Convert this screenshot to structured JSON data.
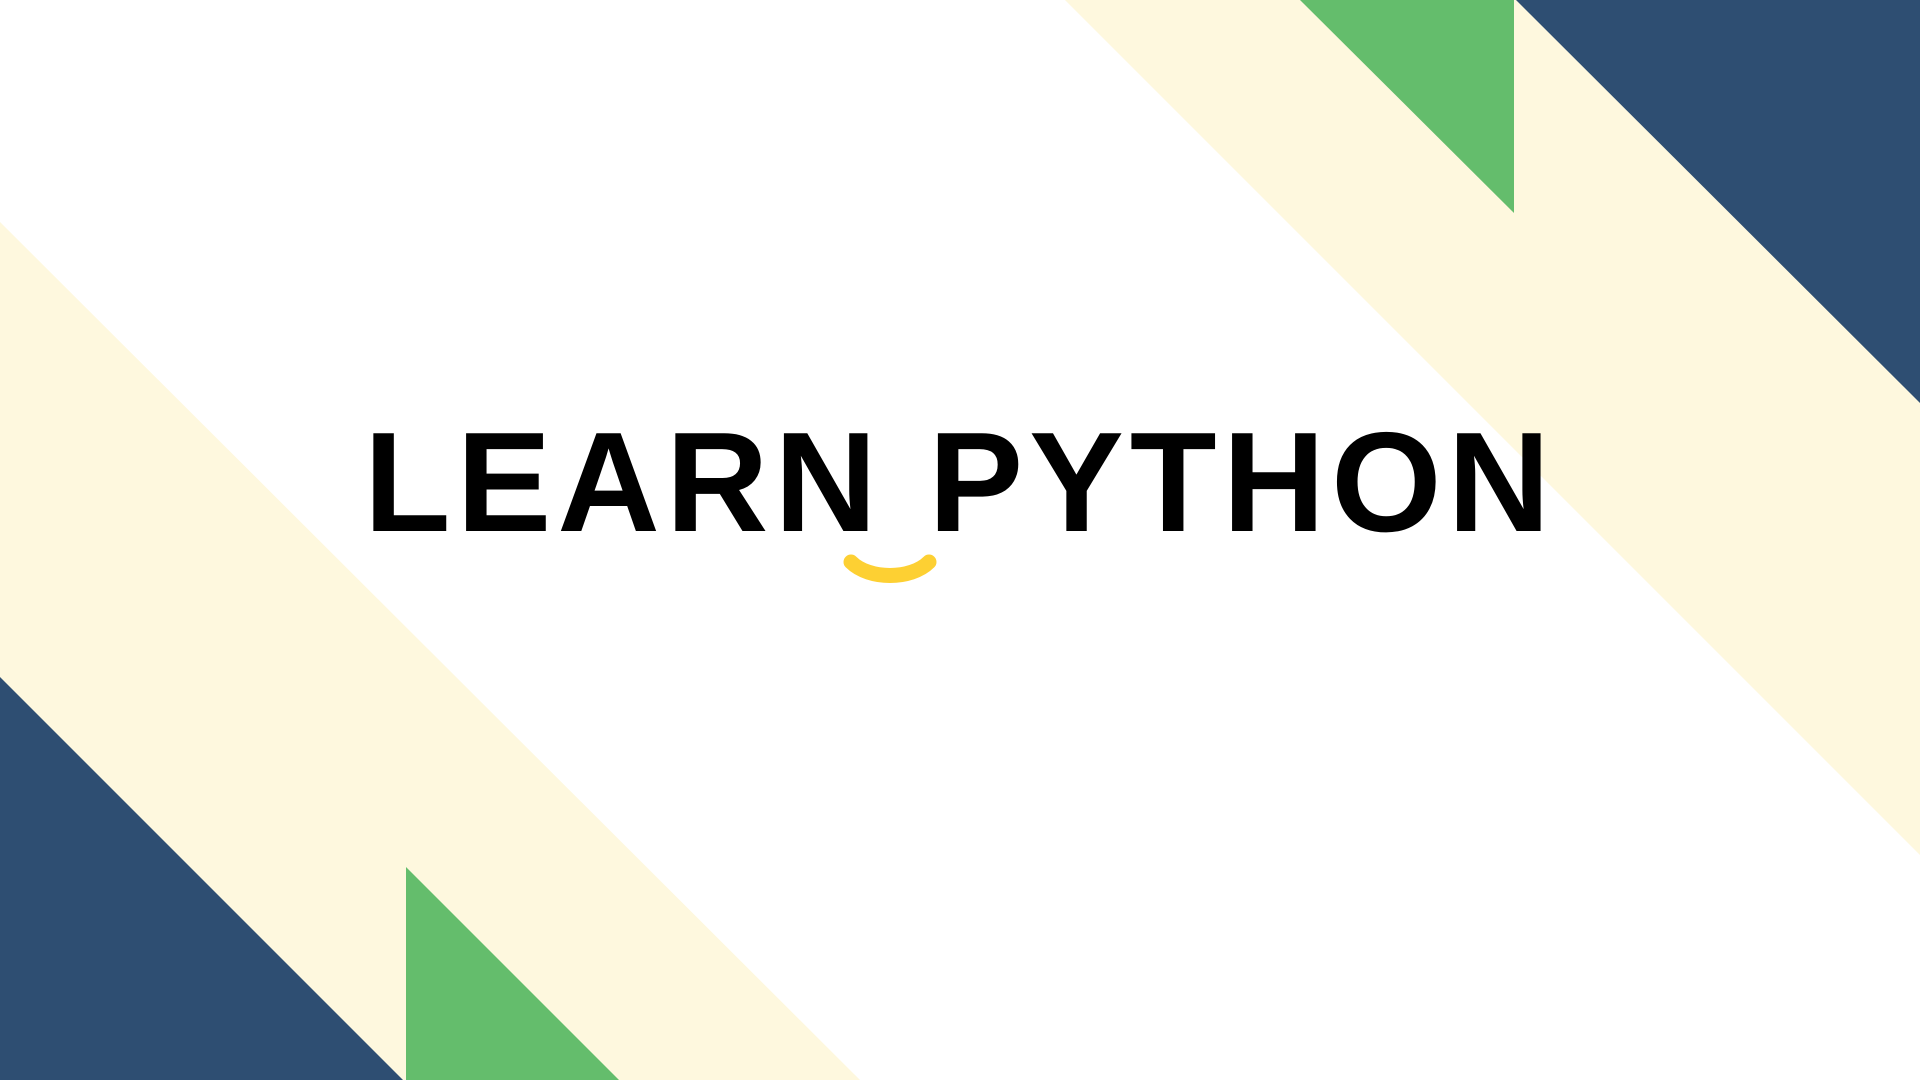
{
  "slide": {
    "title": "LEARN PYTHON",
    "underline_icon": "smile-underline-icon"
  },
  "colors": {
    "background": "#ffffff",
    "cream": "#fef8de",
    "green": "#64bd6c",
    "navy": "#2e4e72",
    "title_text": "#000000",
    "accent_yellow": "#fdd033"
  }
}
